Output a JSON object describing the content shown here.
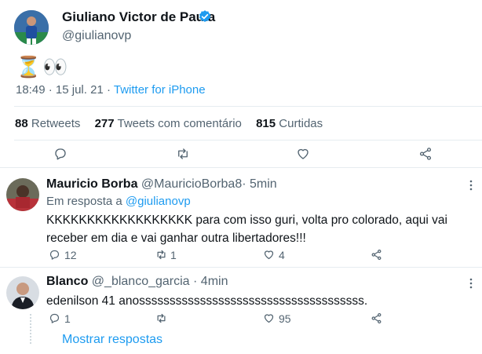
{
  "tweet": {
    "author_name": "Giuliano Victor de Paula",
    "author_handle": "@giulianovp",
    "text": "⏳👀",
    "time": "18:49",
    "date": "15 jul. 21",
    "sep": "·",
    "client": "Twitter for iPhone",
    "stats": {
      "retweets_count": "88",
      "retweets_label": "Retweets",
      "quotes_count": "277",
      "quotes_label": "Tweets com comentário",
      "likes_count": "815",
      "likes_label": "Curtidas"
    }
  },
  "replies": [
    {
      "name": "Mauricio Borba",
      "handle": "@MauricioBorba8",
      "sep": "·",
      "time": "5min",
      "reply_prefix": "Em resposta a",
      "reply_to": "@giulianovp",
      "text": "KKKKKKKKKKKKKKKKKK para com isso guri, volta pro colorado, aqui vai receber em dia e vai ganhar outra libertadores!!!",
      "reply_count": "12",
      "retweet_count": "1",
      "like_count": "4"
    },
    {
      "name": "Blanco",
      "handle": "@_blanco_garcia",
      "sep": "·",
      "time": "4min",
      "text": "edenilson 41 anosssssssssssssssssssssssssssssssssssss.",
      "reply_count": "1",
      "retweet_count": "",
      "like_count": "95"
    }
  ],
  "show_replies": "Mostrar respostas",
  "icons": [
    "verified-icon",
    "reply-icon",
    "retweet-icon",
    "like-icon",
    "share-icon",
    "more-icon"
  ],
  "colors": {
    "accent": "#1d9bf0",
    "muted": "#536471",
    "text": "#0f1419",
    "divider": "#e6ecf0"
  }
}
